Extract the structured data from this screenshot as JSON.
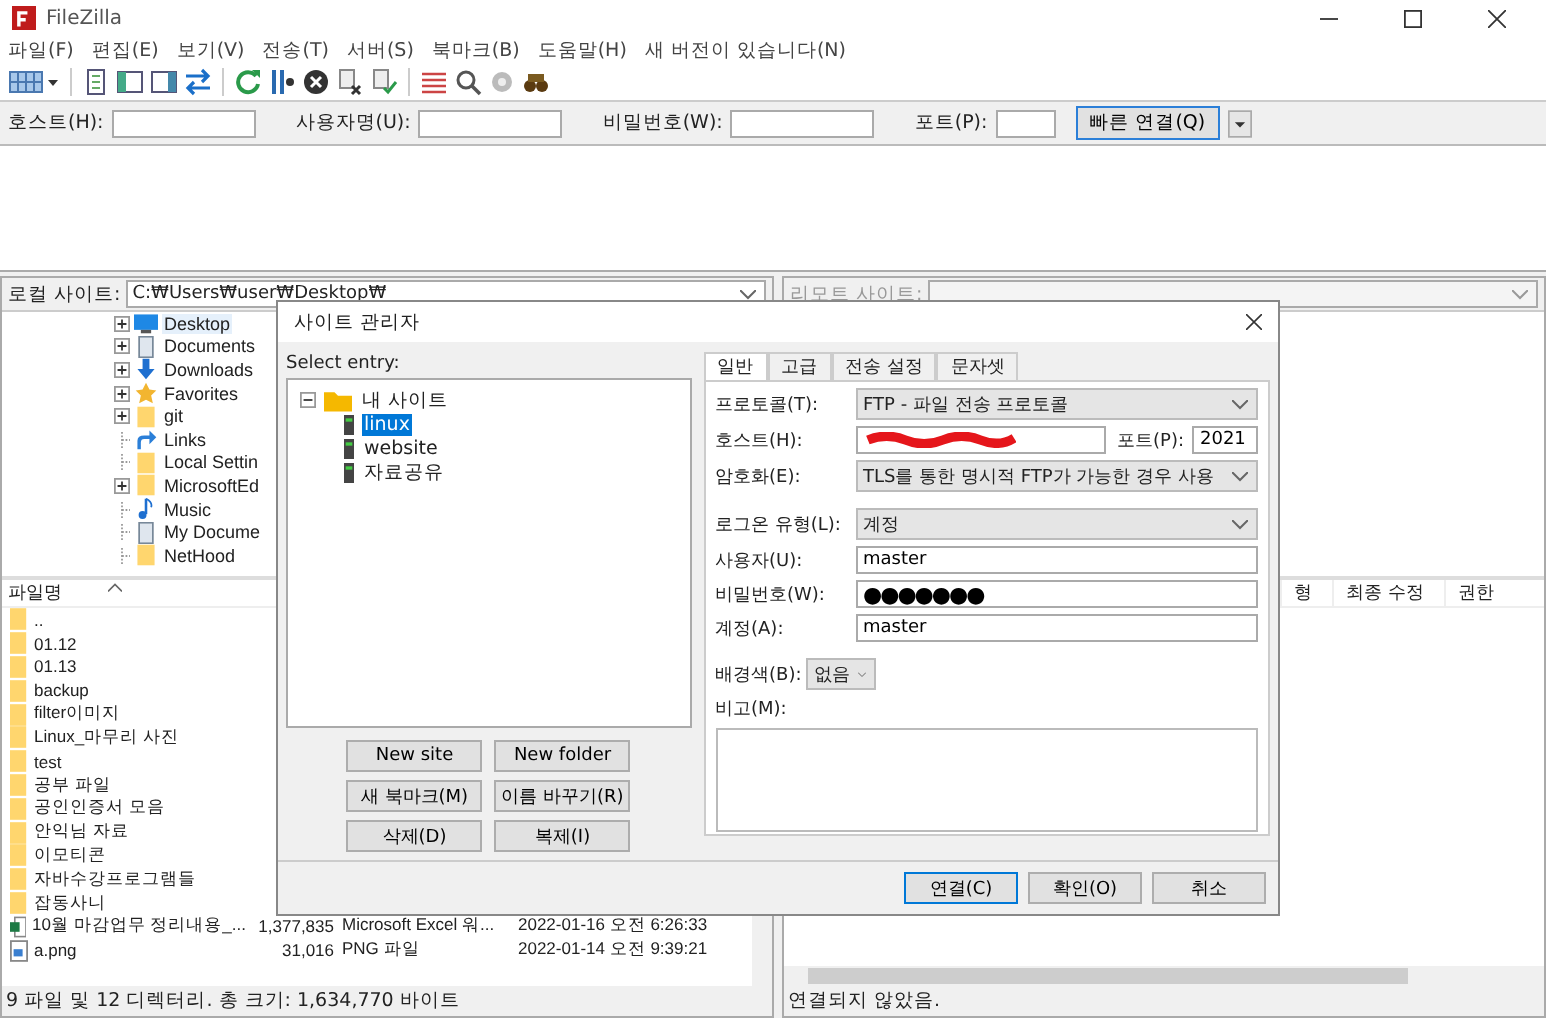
{
  "window": {
    "title": "FileZilla"
  },
  "menu": [
    "파일(F)",
    "편집(E)",
    "보기(V)",
    "전송(T)",
    "서버(S)",
    "북마크(B)",
    "도움말(H)",
    "새 버전이 있습니다(N)"
  ],
  "quickconnect": {
    "fields": [
      {
        "label": "호스트(H):",
        "kind": "text"
      },
      {
        "label": "사용자명(U):",
        "kind": "text"
      },
      {
        "label": "비밀번호(W):",
        "kind": "text"
      },
      {
        "label": "포트(P):",
        "kind": "port"
      }
    ],
    "button": "빠른 연결(Q)"
  },
  "local_site": {
    "label": "로컬 사이트:",
    "path": "C:₩Users₩user₩Desktop₩"
  },
  "local_tree": [
    {
      "label": "Desktop",
      "kind": "desktop",
      "expandable": true,
      "selected": true
    },
    {
      "label": "Documents",
      "kind": "document",
      "expandable": true,
      "selected": false
    },
    {
      "label": "Downloads",
      "kind": "download",
      "expandable": true,
      "selected": false
    },
    {
      "label": "Favorites",
      "kind": "star",
      "expandable": true,
      "selected": false
    },
    {
      "label": "git",
      "kind": "folder",
      "expandable": true,
      "selected": false
    },
    {
      "label": "Links",
      "kind": "link",
      "expandable": false,
      "selected": false
    },
    {
      "label": "Local Settin",
      "kind": "folder",
      "expandable": false,
      "selected": false
    },
    {
      "label": "MicrosoftEd",
      "kind": "folder",
      "expandable": true,
      "selected": false
    },
    {
      "label": "Music",
      "kind": "music",
      "expandable": false,
      "selected": false
    },
    {
      "label": "My Docume",
      "kind": "document",
      "expandable": false,
      "selected": false
    },
    {
      "label": "NetHood",
      "kind": "folder",
      "expandable": false,
      "selected": false
    }
  ],
  "remote_site": {
    "label": "리모트 사이트:",
    "disabled": true
  },
  "local_files": {
    "columns": [
      "파일명"
    ],
    "rows": [
      {
        "name": "..",
        "kind": "folder"
      },
      {
        "name": "01.12",
        "kind": "folder"
      },
      {
        "name": "01.13",
        "kind": "folder"
      },
      {
        "name": "backup",
        "kind": "folder"
      },
      {
        "name": "filter이미지",
        "kind": "folder"
      },
      {
        "name": "Linux_마무리 사진",
        "kind": "folder"
      },
      {
        "name": "test",
        "kind": "folder"
      },
      {
        "name": "공부 파일",
        "kind": "folder"
      },
      {
        "name": "공인인증서 모음",
        "kind": "folder"
      },
      {
        "name": "안익님 자료",
        "kind": "folder"
      },
      {
        "name": "이모티콘",
        "kind": "folder"
      },
      {
        "name": "자바수강프로그램들",
        "kind": "folder"
      },
      {
        "name": "잡동사니",
        "kind": "folder"
      },
      {
        "name": "10월 마감업무 정리내용_...",
        "kind": "excel",
        "size": "1,377,835",
        "type": "Microsoft Excel 워...",
        "modified": "2022-01-16 오전 6:26:33"
      },
      {
        "name": "a.png",
        "kind": "image",
        "size": "31,016",
        "type": "PNG 파일",
        "modified": "2022-01-14 오전 9:39:21"
      }
    ]
  },
  "local_status": "9 파일 및 12 디렉터리. 총 크기: 1,634,770 바이트",
  "remote_files": {
    "columns": [
      "형",
      "최종 수정",
      "권한"
    ]
  },
  "remote_status": "연결되지 않았음.",
  "dialog": {
    "title": "사이트 관리자",
    "select_label": "Select entry:",
    "tree": {
      "label": "내 사이트",
      "expanded": true,
      "children": [
        {
          "label": "linux",
          "selected": true
        },
        {
          "label": "website",
          "selected": false
        },
        {
          "label": "자료공유",
          "selected": false
        }
      ]
    },
    "buttons": [
      "New site",
      "New folder",
      "새 북마크(M)",
      "이름 바꾸기(R)",
      "삭제(D)",
      "복제(I)"
    ],
    "tabs": [
      {
        "label": "일반",
        "selected": true
      },
      {
        "label": "고급",
        "selected": false
      },
      {
        "label": "전송 설정",
        "selected": false
      },
      {
        "label": "문자셋",
        "selected": false
      }
    ],
    "form": [
      {
        "kind": "select",
        "label": "프로토콜(T):",
        "value": "FTP - 파일 전송 프로토콜"
      },
      {
        "kind": "host",
        "label": "호스트(H):",
        "port_label": "포트(P):",
        "port": "2021"
      },
      {
        "kind": "select",
        "label": "암호화(E):",
        "value": "TLS를 통한 명시적 FTP가 가능한 경우 사용"
      },
      {
        "kind": "separator"
      },
      {
        "kind": "select",
        "label": "로그온 유형(L):",
        "value": "계정"
      },
      {
        "kind": "input",
        "label": "사용자(U):",
        "value": "master"
      },
      {
        "kind": "password",
        "label": "비밀번호(W):",
        "value": "●●●●●●●"
      },
      {
        "kind": "input",
        "label": "계정(A):",
        "value": "master"
      },
      {
        "kind": "separator"
      },
      {
        "kind": "small-select",
        "label": "배경색(B):",
        "value": "없음"
      },
      {
        "kind": "textarea",
        "label": "비고(M):"
      }
    ],
    "footer": [
      "연결(C)",
      "확인(O)",
      "취소"
    ]
  }
}
